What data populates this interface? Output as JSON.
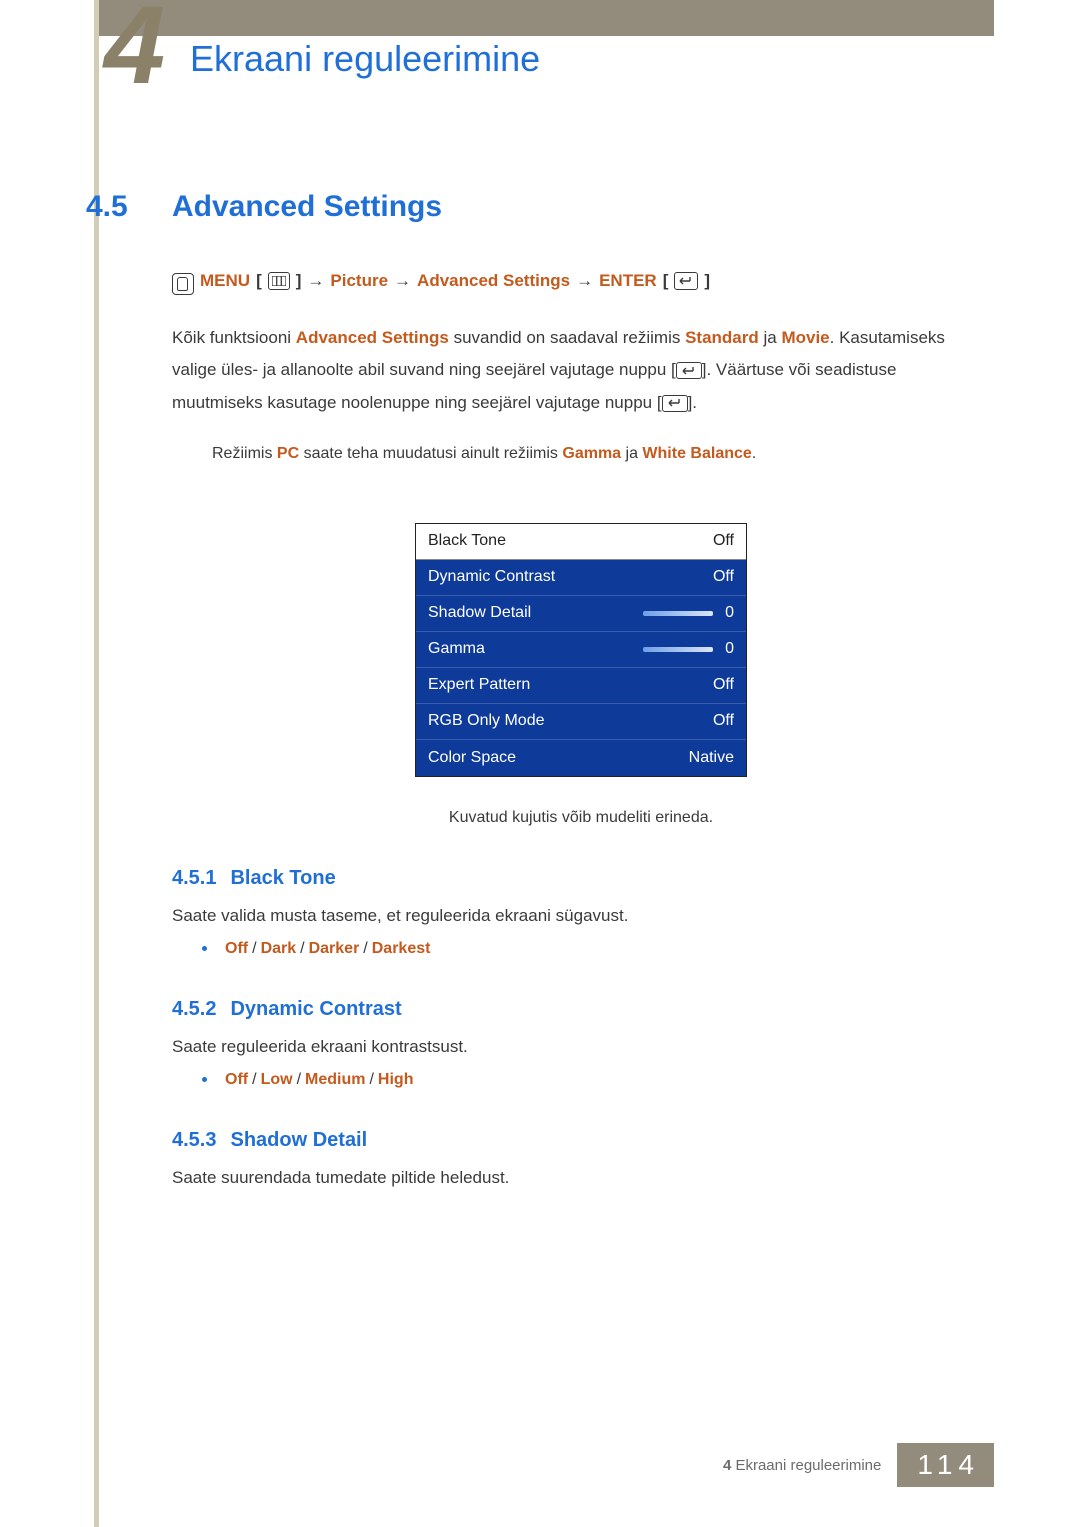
{
  "chapter": {
    "big_number": "4",
    "title": "Ekraani reguleerimine"
  },
  "section": {
    "number": "4.5",
    "title": "Advanced Settings"
  },
  "menu_path": {
    "menu_label": "MENU",
    "picture": "Picture",
    "adv": "Advanced Settings",
    "enter": "ENTER"
  },
  "paragraphs": {
    "p1_a": "Kõik funktsiooni ",
    "p1_hl1": "Advanced Settings",
    "p1_b": " suvandid on saadaval režiimis ",
    "p1_hl2": "Standard",
    "p1_c": " ja ",
    "p1_hl3": "Movie",
    "p1_d": ". Kasutamiseks valige üles- ja allanoolte abil suvand ning seejärel vajutage nuppu [",
    "p1_e": "]. Väärtuse või seadistuse muutmiseks kasutage noolenuppe ning seejärel vajutage nuppu [",
    "p1_f": "]."
  },
  "note": {
    "a": "Režiimis ",
    "hl1": "PC",
    "b": " saate teha muudatusi ainult režiimis ",
    "hl2": "Gamma",
    "c": " ja ",
    "hl3": "White Balance",
    "d": "."
  },
  "menu_panel": {
    "rows": [
      {
        "label": "Black Tone",
        "value": "Off",
        "slider": false,
        "light": true
      },
      {
        "label": "Dynamic Contrast",
        "value": "Off",
        "slider": false,
        "light": false
      },
      {
        "label": "Shadow Detail",
        "value": "0",
        "slider": true,
        "light": false
      },
      {
        "label": "Gamma",
        "value": "0",
        "slider": true,
        "light": false
      },
      {
        "label": "Expert Pattern",
        "value": "Off",
        "slider": false,
        "light": false
      },
      {
        "label": "RGB Only Mode",
        "value": "Off",
        "slider": false,
        "light": false
      },
      {
        "label": "Color Space",
        "value": "Native",
        "slider": false,
        "light": false
      }
    ],
    "caption": "Kuvatud kujutis võib mudeliti erineda."
  },
  "subsections": [
    {
      "num": "4.5.1",
      "title": "Black Tone",
      "body": "Saate valida musta taseme, et reguleerida ekraani sügavust.",
      "options": [
        "Off",
        "Dark",
        "Darker",
        "Darkest"
      ]
    },
    {
      "num": "4.5.2",
      "title": "Dynamic Contrast",
      "body": "Saate reguleerida ekraani kontrastsust.",
      "options": [
        "Off",
        "Low",
        "Medium",
        "High"
      ]
    },
    {
      "num": "4.5.3",
      "title": "Shadow Detail",
      "body": "Saate suurendada tumedate piltide heledust.",
      "options": []
    }
  ],
  "footer": {
    "label_prefix": "4",
    "label": "Ekraani reguleerimine",
    "page": "114"
  }
}
